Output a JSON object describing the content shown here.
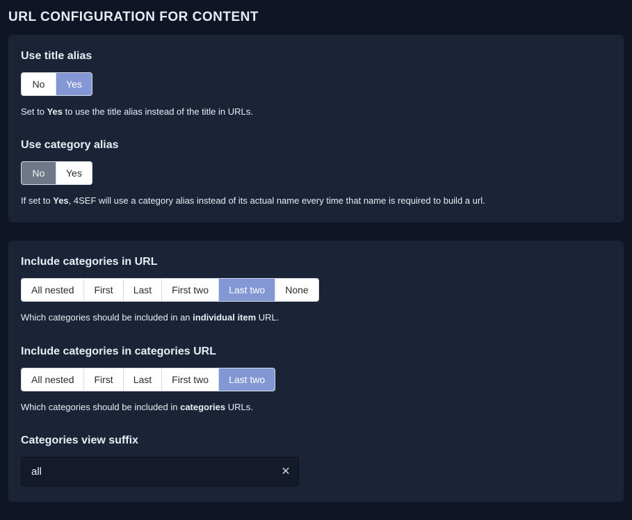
{
  "page_title": "URL CONFIGURATION FOR CONTENT",
  "panel1": {
    "use_title_alias": {
      "label": "Use title alias",
      "options": {
        "no": "No",
        "yes": "Yes"
      },
      "selected": "yes",
      "help_pre": "Set to ",
      "help_bold": "Yes",
      "help_post": " to use the title alias instead of the title in URLs."
    },
    "use_category_alias": {
      "label": "Use category alias",
      "options": {
        "no": "No",
        "yes": "Yes"
      },
      "selected": "no",
      "help_pre": "If set to ",
      "help_bold": "Yes",
      "help_post": ", 4SEF will use a category alias instead of its actual name every time that name is required to build a url."
    }
  },
  "panel2": {
    "include_cats_item": {
      "label": "Include categories in URL",
      "options": [
        "All nested",
        "First",
        "Last",
        "First two",
        "Last two",
        "None"
      ],
      "selected_index": 4,
      "help_pre": "Which categories should be included in an ",
      "help_bold": "individual item",
      "help_post": " URL."
    },
    "include_cats_cats": {
      "label": "Include categories in categories URL",
      "options": [
        "All nested",
        "First",
        "Last",
        "First two",
        "Last two"
      ],
      "selected_index": 4,
      "help_pre": "Which categories should be included in ",
      "help_bold": "categories",
      "help_post": " URLs."
    },
    "categories_view_suffix": {
      "label": "Categories view suffix",
      "value": "all",
      "clear_icon": "✕"
    }
  }
}
